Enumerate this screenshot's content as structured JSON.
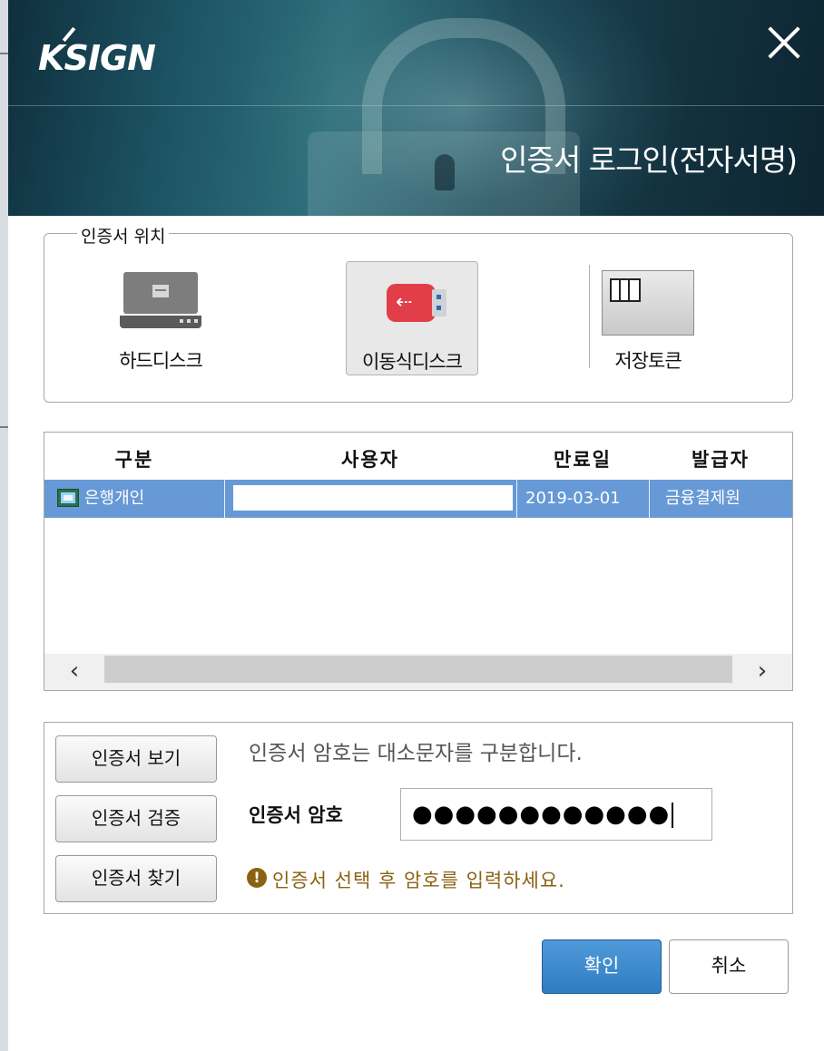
{
  "header": {
    "logo": "KSIGN",
    "title": "인증서 로그인(전자서명)",
    "close_icon": "close-icon"
  },
  "location": {
    "legend": "인증서 위치",
    "items": [
      {
        "label": "하드디스크",
        "icon": "hard-disk-icon"
      },
      {
        "label": "이동식디스크",
        "icon": "usb-drive-icon",
        "selected": true
      },
      {
        "label": "저장토큰",
        "icon": "security-token-icon"
      }
    ]
  },
  "cert_table": {
    "columns": [
      "구분",
      "사용자",
      "만료일",
      "발급자"
    ],
    "rows": [
      {
        "type": "은행개인",
        "user": "",
        "expiry": "2019-03-01",
        "issuer": "금융결제원",
        "selected": true
      }
    ],
    "scroll_left": "‹",
    "scroll_right": "›"
  },
  "password": {
    "buttons": [
      "인증서 보기",
      "인증서 검증",
      "인증서 찾기"
    ],
    "note": "인증서 암호는 대소문자를 구분합니다.",
    "label": "인증서 암호",
    "value": "●●●●●●●●●●●●",
    "warning": "인증서 선택 후 암호를 입력하세요.",
    "warning_icon": "exclamation-icon"
  },
  "actions": {
    "ok": "확인",
    "cancel": "취소"
  },
  "colors": {
    "selection": "#6699d6",
    "ok_button": "#2f7cc3",
    "warning": "#8a6212",
    "usb_red": "#e13e4a"
  }
}
